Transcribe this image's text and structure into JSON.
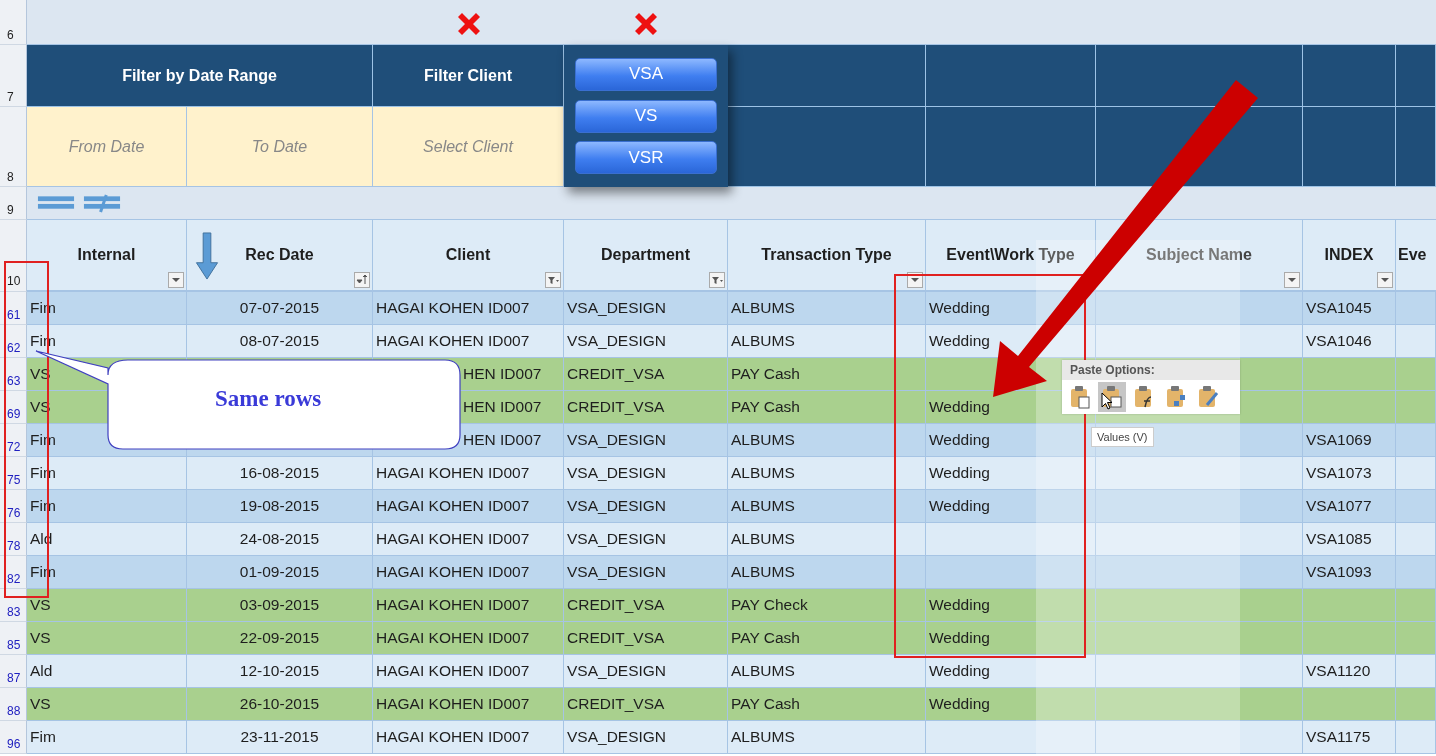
{
  "top_row_numbers": [
    "6",
    "7",
    "8",
    "9",
    "10"
  ],
  "filter_panel": {
    "date_title": "Filter by Date Range",
    "client_title": "Filter Client",
    "from_placeholder": "From Date",
    "to_placeholder": "To Date",
    "client_placeholder": "Select Client",
    "buttons": [
      "VSA",
      "VS",
      "VSR"
    ]
  },
  "columns": [
    {
      "name": "Internal",
      "kind": "dropdown"
    },
    {
      "name": "Rec Date",
      "kind": "sort"
    },
    {
      "name": "Client",
      "kind": "filtered"
    },
    {
      "name": "Department",
      "kind": "filtered"
    },
    {
      "name": "Transaction Type",
      "kind": "dropdown"
    },
    {
      "name": "Event\\Work Type",
      "kind": "plain"
    },
    {
      "name": "Subject Name",
      "kind": "dropdown"
    },
    {
      "name": "INDEX",
      "kind": "dropdown"
    },
    {
      "name": "Eve",
      "kind": "plain"
    }
  ],
  "rows": [
    {
      "num": "61",
      "color": "#bdd7ee",
      "internal": "Fim",
      "rec_date": "07-07-2015",
      "client": "HAGAI KOHEN ID007",
      "department": "VSA_DESIGN",
      "transaction_type": "ALBUMS",
      "event": "Wedding",
      "index": "VSA1045"
    },
    {
      "num": "62",
      "color": "#ddebf7",
      "internal": "Fim",
      "rec_date": "08-07-2015",
      "client": "HAGAI KOHEN ID007",
      "department": "VSA_DESIGN",
      "transaction_type": "ALBUMS",
      "event": "Wedding",
      "index": "VSA1046"
    },
    {
      "num": "63",
      "color": "#a9d08e",
      "internal": "VS",
      "client": "HEN ID007",
      "department": "CREDIT_VSA",
      "transaction_type": "PAY Cash"
    },
    {
      "num": "69",
      "color": "#a9d08e",
      "internal": "VS",
      "client": "HEN ID007",
      "department": "CREDIT_VSA",
      "transaction_type": "PAY Cash",
      "event": "Wedding"
    },
    {
      "num": "72",
      "color": "#bdd7ee",
      "internal": "Fim",
      "client": "HEN ID007",
      "department": "VSA_DESIGN",
      "transaction_type": "ALBUMS",
      "event": "Wedding",
      "index": "VSA1069"
    },
    {
      "num": "75",
      "color": "#ddebf7",
      "internal": "Fim",
      "rec_date": "16-08-2015",
      "client": "HAGAI KOHEN ID007",
      "department": "VSA_DESIGN",
      "transaction_type": "ALBUMS",
      "event": "Wedding",
      "index": "VSA1073"
    },
    {
      "num": "76",
      "color": "#bdd7ee",
      "internal": "Fim",
      "rec_date": "19-08-2015",
      "client": "HAGAI KOHEN ID007",
      "department": "VSA_DESIGN",
      "transaction_type": "ALBUMS",
      "event": "Wedding",
      "index": "VSA1077"
    },
    {
      "num": "78",
      "color": "#ddebf7",
      "internal": "Ald",
      "rec_date": "24-08-2015",
      "client": "HAGAI KOHEN ID007",
      "department": "VSA_DESIGN",
      "transaction_type": "ALBUMS",
      "index": "VSA1085"
    },
    {
      "num": "82",
      "color": "#bdd7ee",
      "internal": "Fim",
      "rec_date": "01-09-2015",
      "client": "HAGAI KOHEN ID007",
      "department": "VSA_DESIGN",
      "transaction_type": "ALBUMS",
      "index": "VSA1093"
    },
    {
      "num": "83",
      "color": "#a9d08e",
      "internal": "VS",
      "rec_date": "03-09-2015",
      "client": "HAGAI KOHEN ID007",
      "department": "CREDIT_VSA",
      "transaction_type": "PAY Check",
      "event": "Wedding"
    },
    {
      "num": "85",
      "color": "#a9d08e",
      "internal": "VS",
      "rec_date": "22-09-2015",
      "client": "HAGAI KOHEN ID007",
      "department": "CREDIT_VSA",
      "transaction_type": "PAY Cash",
      "event": "Wedding"
    },
    {
      "num": "87",
      "color": "#ddebf7",
      "internal": "Ald",
      "rec_date": "12-10-2015",
      "client": "HAGAI KOHEN ID007",
      "department": "VSA_DESIGN",
      "transaction_type": "ALBUMS",
      "event": "Wedding",
      "index": "VSA1120"
    },
    {
      "num": "88",
      "color": "#a9d08e",
      "internal": "VS",
      "rec_date": "26-10-2015",
      "client": "HAGAI KOHEN ID007",
      "department": "CREDIT_VSA",
      "transaction_type": "PAY Cash",
      "event": "Wedding"
    },
    {
      "num": "96",
      "color": "#ddebf7",
      "internal": "Fim",
      "rec_date": "23-11-2015",
      "client": "HAGAI KOHEN ID007",
      "department": "VSA_DESIGN",
      "transaction_type": "ALBUMS",
      "index": "VSA1175"
    }
  ],
  "callout": "Same rows",
  "paste_options": {
    "title": "Paste Options:",
    "options": [
      {
        "selected": false
      },
      {
        "selected": true
      },
      {
        "selected": false
      },
      {
        "selected": false
      },
      {
        "selected": false
      }
    ],
    "tooltip": "Values (V)"
  }
}
